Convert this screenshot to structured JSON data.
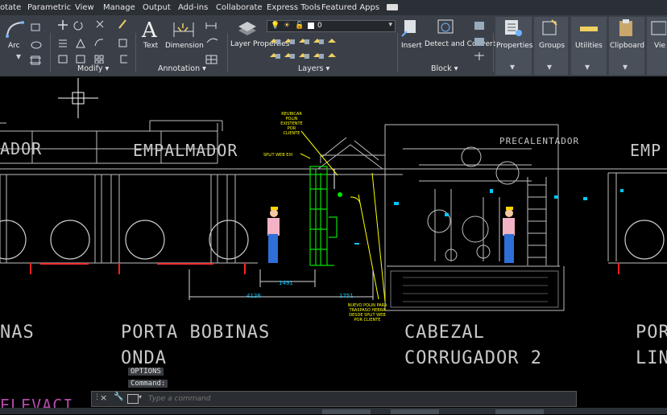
{
  "menu": [
    "otate",
    "Parametric",
    "View",
    "Manage",
    "Output",
    "Add-ins",
    "Collaborate",
    "Express Tools",
    "Featured Apps"
  ],
  "ribbon": {
    "arc_label": "Arc",
    "text_label": "Text",
    "dimension_label": "Dimension",
    "layer_properties_label": "Layer Properties",
    "layer_value": "0",
    "insert_label": "Insert",
    "detect_convert_label": "Detect and Convert",
    "properties_label": "Properties",
    "groups_label": "Groups",
    "utilities_label": "Utilities",
    "clipboard_label": "Clipboard",
    "view_label": "Vie",
    "panels": {
      "modify": "Modify ▾",
      "annotation": "Annotation ▾",
      "layers": "Layers ▾",
      "block": "Block ▾"
    }
  },
  "drawing": {
    "labels": {
      "empalmador_left": "ADOR",
      "empalmador": "EMPALMADOR",
      "precalentador": "PRECALENTADOR",
      "empalmador_right": "EMP",
      "nas": "NAS",
      "porta_bobinas": "PORTA BOBINAS",
      "onda": "ONDA",
      "cabezal": "CABEZAL",
      "corrugador": "CORRUGADOR 2",
      "por_right": "POR",
      "lin_right": "LIN",
      "elevacion": "ELEVACI"
    },
    "dims": {
      "d1": "1491",
      "d2": "4126",
      "d3": "1751"
    },
    "notes": {
      "note1": [
        "REUBICAR",
        "POLIN",
        "EXISTENTE",
        "POR",
        "CLIENTE"
      ],
      "note2": "SPLIT WEB EXI",
      "note3": [
        "NUEVO POLIN PARA",
        "TRASPASO HEBRA",
        "DESDE SPLIT WEB",
        "POR CLIENTE"
      ]
    }
  },
  "command": {
    "history": [
      "OPTIONS",
      "Command:"
    ],
    "placeholder": "Type a command"
  },
  "colors": {
    "ribbon": "#3b4048",
    "menubar": "#2b2f36",
    "canvas": "#000000",
    "green": "#00e000",
    "yellow": "#ffff00",
    "cyan": "#00c8ff"
  }
}
